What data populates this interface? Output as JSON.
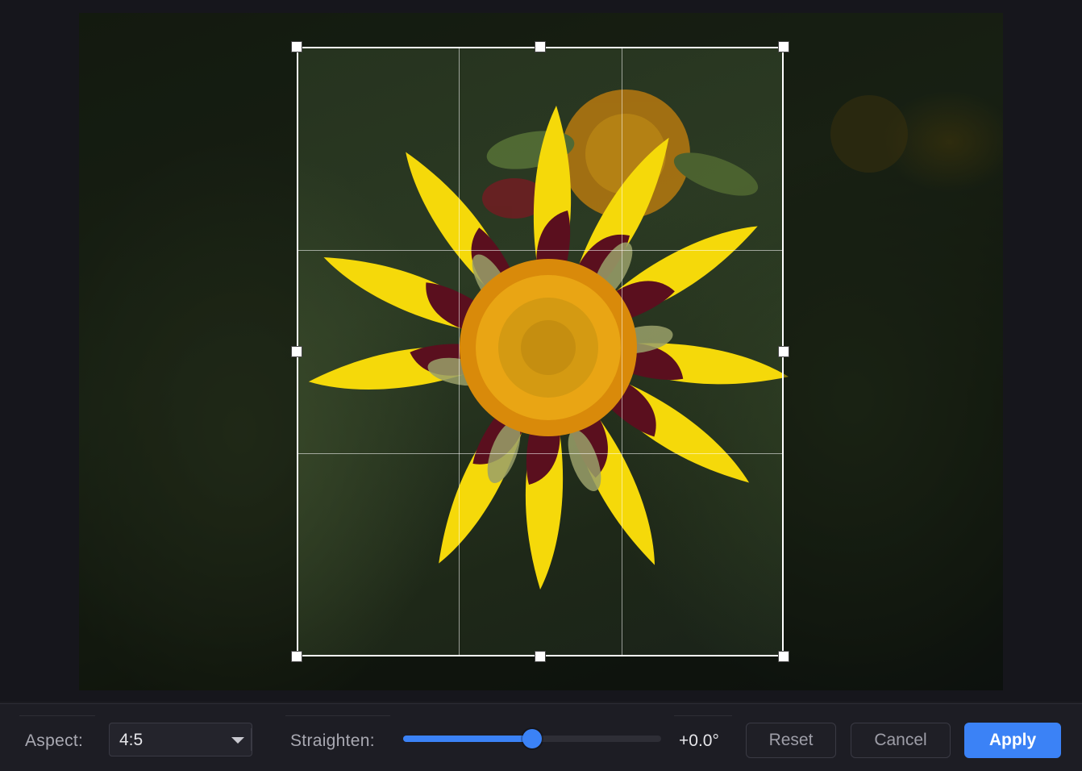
{
  "toolbar": {
    "aspect_label": "Aspect:",
    "aspect_value": "4:5",
    "straighten_label": "Straighten:",
    "straighten_level": 0.5,
    "straighten_value": "+0.0°",
    "reset_label": "Reset",
    "cancel_label": "Cancel",
    "apply_label": "Apply"
  },
  "colors": {
    "accent": "#3b82f6",
    "petal_yellow": "#f5d90a",
    "petal_maroon": "#5a0f1e",
    "center_orange": "#e8a20c"
  },
  "icons": {
    "dropdown": "chevron-down-icon"
  }
}
